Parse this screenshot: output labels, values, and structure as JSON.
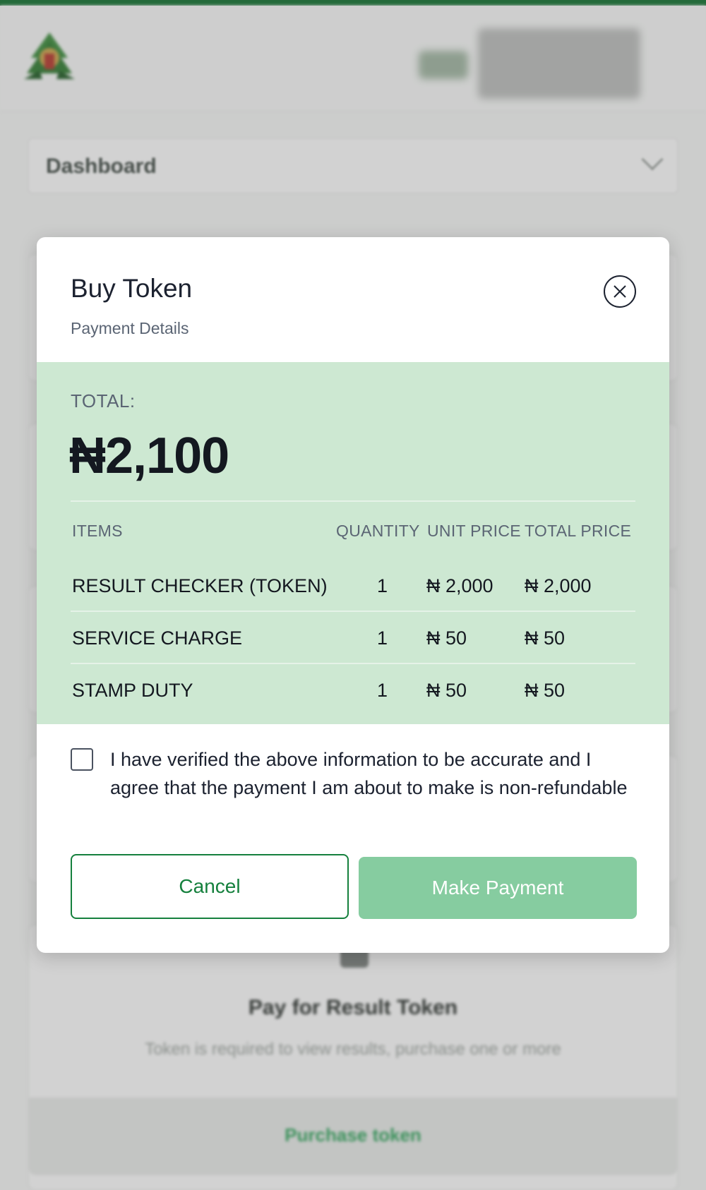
{
  "background": {
    "nav_select": "Dashboard",
    "card": {
      "title": "Pay for Result Token",
      "description": "Token is required to view results, purchase one or more",
      "action": "Purchase token"
    }
  },
  "modal": {
    "title": "Buy Token",
    "subtitle": "Payment Details",
    "total_label": "TOTAL:",
    "total_amount": "₦2,100",
    "columns": {
      "items": "ITEMS",
      "quantity": "QUANTITY",
      "unit_price": "UNIT PRICE",
      "total_price": "TOTAL PRICE"
    },
    "rows": [
      {
        "item": "RESULT CHECKER (TOKEN)",
        "quantity": "1",
        "unit_price": "₦ 2,000",
        "total_price": "₦ 2,000"
      },
      {
        "item": "SERVICE CHARGE",
        "quantity": "1",
        "unit_price": "₦ 50",
        "total_price": "₦ 50"
      },
      {
        "item": "STAMP DUTY",
        "quantity": "1",
        "unit_price": "₦ 50",
        "total_price": "₦ 50"
      }
    ],
    "agreement": "I have verified the above information to be accurate and I agree that the payment I am about to make is non-refundable",
    "agreement_checked": false,
    "cancel_label": "Cancel",
    "pay_label": "Make Payment"
  },
  "colors": {
    "brand_green": "#15803d",
    "summary_bg": "#cde8d2",
    "pay_button_disabled": "#86cca0"
  },
  "icons": {
    "close": "close-icon",
    "logo": "logo-icon"
  }
}
